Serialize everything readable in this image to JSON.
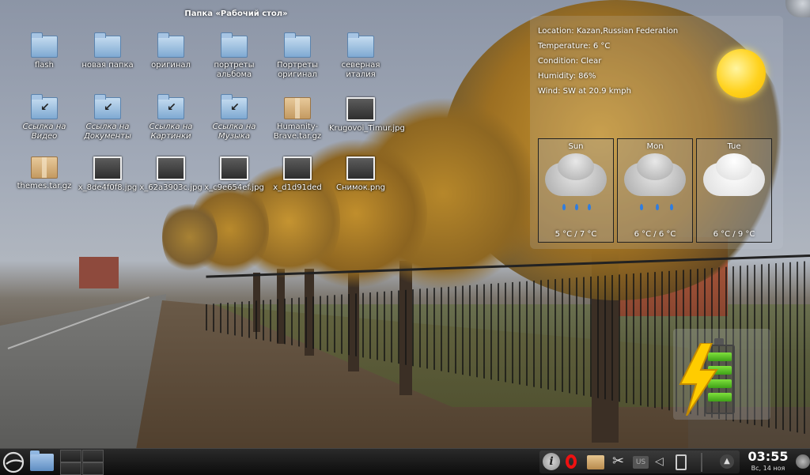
{
  "folder": {
    "title": "Папка «Рабочий стол»",
    "items": [
      {
        "label": "flash",
        "kind": "folder",
        "italic": false
      },
      {
        "label": "новая папка",
        "kind": "folder",
        "italic": false
      },
      {
        "label": "оригинал",
        "kind": "folder",
        "italic": false
      },
      {
        "label": "портреты альбома",
        "kind": "folder",
        "italic": false
      },
      {
        "label": "Портреты оригинал",
        "kind": "folder",
        "italic": false
      },
      {
        "label": "северная италия",
        "kind": "folder",
        "italic": false
      },
      {
        "label": "Ссылка на Видео",
        "kind": "folder-link",
        "italic": true
      },
      {
        "label": "Ссылка на Документы",
        "kind": "folder-link",
        "italic": true
      },
      {
        "label": "Ссылка на Картинки",
        "kind": "folder-link",
        "italic": true
      },
      {
        "label": "Ссылка на Музыка",
        "kind": "folder-link",
        "italic": true
      },
      {
        "label": "Humanity-Brave.tar.gz",
        "kind": "archive",
        "italic": false
      },
      {
        "label": "Krugovoi_Timur.jpg",
        "kind": "image",
        "italic": false
      },
      {
        "label": "themes.tar.gz",
        "kind": "archive",
        "italic": false
      },
      {
        "label": "x_8de4f0f8.jpg",
        "kind": "image",
        "italic": false
      },
      {
        "label": "x_62a3903c.jpg",
        "kind": "image",
        "italic": false
      },
      {
        "label": "x_c9e654ef.jpg",
        "kind": "image",
        "italic": false
      },
      {
        "label": "x_d1d91ded",
        "kind": "image",
        "italic": false
      },
      {
        "label": "Снимок.png",
        "kind": "image",
        "italic": false
      }
    ]
  },
  "weather": {
    "location": "Location: Kazan,Russian Federation",
    "temperature": "Temperature: 6 °C",
    "condition": "Condition: Clear",
    "humidity": "Humidity: 86%",
    "wind": "Wind: SW at 20.9 kmph",
    "current_icon": "sun-icon",
    "forecast": [
      {
        "day": "Sun",
        "temp": "5 °C / 7 °C",
        "icon": "rain-cloud-icon"
      },
      {
        "day": "Mon",
        "temp": "6 °C / 6 °C",
        "icon": "rain-cloud-icon"
      },
      {
        "day": "Tue",
        "temp": "6 °C / 9 °C",
        "icon": "cloud-icon"
      }
    ]
  },
  "battery": {
    "charging": true,
    "level": 1.0
  },
  "panel": {
    "clock_time": "03:55",
    "clock_date": "Вс, 14 ноя",
    "keyboard_layout": "US",
    "tray_icons": [
      "info-icon",
      "opera-icon",
      "package-icon",
      "scissors-icon",
      "keyboard-layout-icon",
      "volume-icon",
      "clipboard-icon",
      "notifications-up-icon"
    ]
  },
  "colors": {
    "panel_bg": "#141414",
    "accent_green": "#4fbf1f",
    "sun": "#ffd21e"
  }
}
